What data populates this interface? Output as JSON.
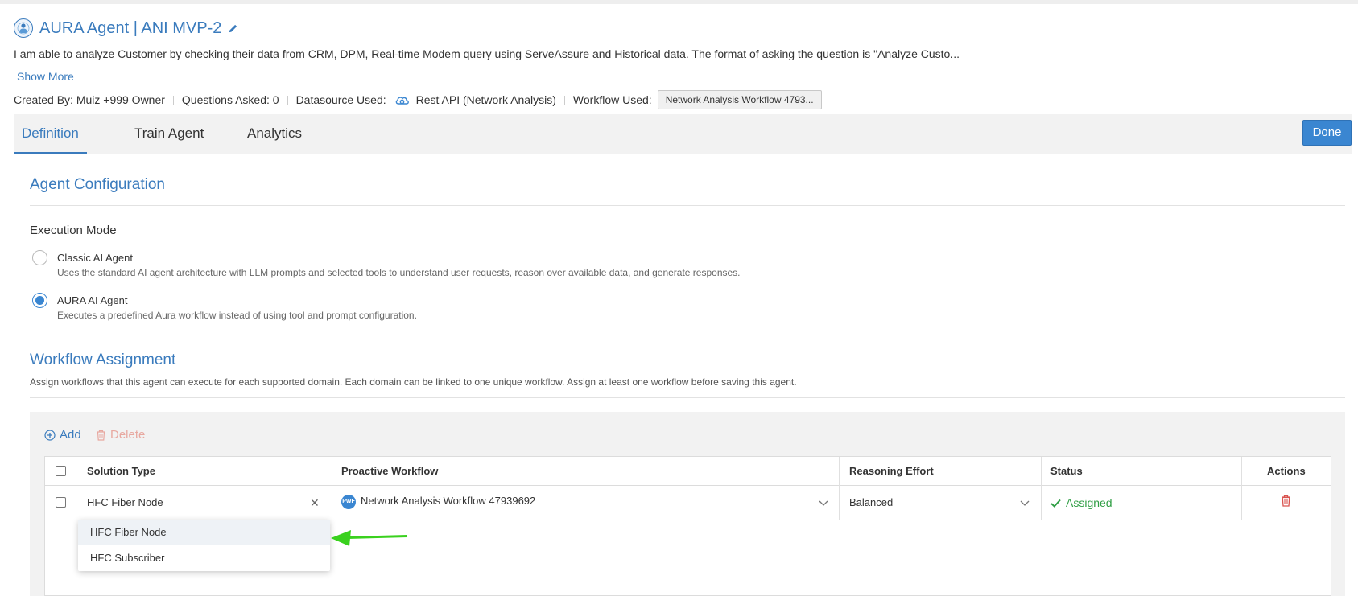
{
  "header": {
    "title": "AURA Agent | ANI MVP-2",
    "description": "I am able to analyze Customer by checking their data from CRM, DPM, Real-time Modem query using ServeAssure and Historical data. The format of asking the question is \"Analyze Custo...",
    "show_more": "Show More",
    "created_by": "Created By: Muiz +999 Owner",
    "questions_asked": "Questions Asked: 0",
    "datasource_label": "Datasource Used:",
    "datasource_value": "Rest API (Network Analysis)",
    "workflow_label": "Workflow Used:",
    "workflow_value": "Network Analysis Workflow 4793..."
  },
  "tabs": [
    {
      "label": "Definition",
      "active": true
    },
    {
      "label": "Train Agent",
      "active": false
    },
    {
      "label": "Analytics",
      "active": false
    }
  ],
  "done_label": "Done",
  "agent_config": {
    "title": "Agent Configuration",
    "execution_mode_label": "Execution Mode",
    "options": [
      {
        "title": "Classic AI Agent",
        "desc": "Uses the standard AI agent architecture with LLM prompts and selected tools to understand user requests, reason over available data, and generate responses.",
        "selected": false
      },
      {
        "title": "AURA AI Agent",
        "desc": "Executes a predefined Aura workflow instead of using tool and prompt configuration.",
        "selected": true
      }
    ]
  },
  "workflow_assignment": {
    "title": "Workflow Assignment",
    "desc": "Assign workflows that this agent can execute for each supported domain. Each domain can be linked to one unique workflow. Assign at least one workflow before saving this agent.",
    "add_label": "Add",
    "delete_label": "Delete",
    "columns": [
      "Solution Type",
      "Proactive Workflow",
      "Reasoning Effort",
      "Status",
      "Actions"
    ],
    "row": {
      "solution_type": "HFC Fiber Node",
      "workflow_badge": "PWF",
      "workflow": "Network Analysis Workflow 47939692",
      "reasoning": "Balanced",
      "status": "Assigned"
    },
    "dropdown_options": [
      "HFC Fiber Node",
      "HFC Subscriber"
    ]
  },
  "colors": {
    "accent": "#3a7bbd",
    "success": "#2f9e44",
    "danger": "#d9534f",
    "arrow": "#3ad11e"
  }
}
